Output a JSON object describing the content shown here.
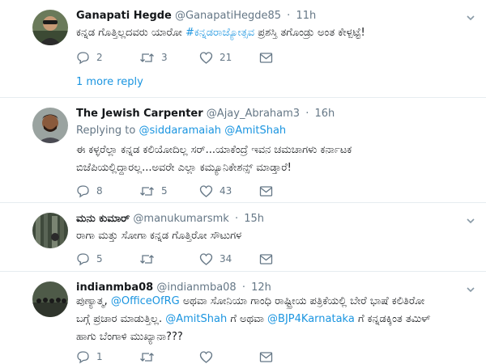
{
  "tweets": [
    {
      "name": "Ganapati Hegde",
      "handle": "@GanapatiHegde85",
      "time": "11h",
      "body": [
        "ಕನ್ನಡ ಗೊತ್ತಿಲ್ಲದವರು ಯಾರೋ ",
        "#ಕನ್ನಡರಾಜ್ಯೋತ್ಸವ",
        " ಪ್ರಶಸ್ತಿ ತಗೊಂಡ್ರು ಅಂತ ಕೇಳ್ಪಟ್ಟೆ!"
      ],
      "replies": "2",
      "retweets": "3",
      "likes": "21",
      "more_replies": "1 more reply"
    },
    {
      "name": "The Jewish Carpenter",
      "handle": "@Ajay_Abraham3",
      "time": "16h",
      "replying_label": "Replying to",
      "replying_to": [
        "@siddaramaiah",
        "@AmitShah"
      ],
      "body_lines": [
        "ಈ ಕಳ್ಳರೆಲ್ಲಾ ಕನ್ನಡ ಕಲಿಯೋದಿಲ್ಲ ಸರ್...ಯಾಕೆಂದ್ರೆ ಇವನ ಚಮಚಾಗಳು ಕರ್ನಾಟಕ",
        "ಬಿಜೆಪಿಯಲ್ಲಿದ್ದಾರಲ್ಲ...ಅವರೇ ಎಲ್ಲಾ ಕಮ್ಯೂನಿಕೇಶನ್ಸ್ ಮಾಡ್ತಾರೆ!"
      ],
      "replies": "8",
      "retweets": "5",
      "likes": "43"
    },
    {
      "name": "ಮನು ಕುಮಾರ್",
      "handle": "@manukumarsmk",
      "time": "15h",
      "body": "ರಾಗಾ ಮತ್ತು ಸೋಗಾ ಕನ್ನಡ ಗೊತ್ತಿರೋ ಸೌಟುಗಳ",
      "replies": "5",
      "retweets": "",
      "likes": "34"
    },
    {
      "name": "indianmba08",
      "handle": "@indianmba08",
      "time": "12h",
      "line1": [
        "ಪುಣ್ಯಾತ್ಮ, ",
        "@OfficeOfRG",
        " ಅಥವಾ ಸೋನಿಯಾ ಗಾಂಧಿ ರಾಷ್ಟ್ರೀಯ ಪತ್ರಿಕೆಯಲ್ಲಿ ಬೇರೆ ಭಾಷೆ ಕಲಿತಿರೋ"
      ],
      "line2": [
        "ಬಗ್ಗೆ ಪ್ರಚಾರ ಮಾಡುತ್ತಿಲ್ಲ. ",
        "@AmitShah",
        " ಗೆ ಅಥವಾ ",
        "@BJP4Karnataka",
        " ಗೆ ಕನ್ನಡಕ್ಕಿಂತ ತಮಿಳ್"
      ],
      "line3": "ಹಾಗು ಬೆಂಗಾಳಿ ಮುಖ್ಯಾನಾ???",
      "replies": "1",
      "retweets": "",
      "likes": ""
    }
  ],
  "colors": {
    "link": "#1b95e0",
    "muted": "#657786",
    "divider": "#e6ecf0"
  },
  "icons": [
    "reply-icon",
    "retweet-icon",
    "like-icon",
    "message-icon",
    "chevron-down-icon"
  ]
}
